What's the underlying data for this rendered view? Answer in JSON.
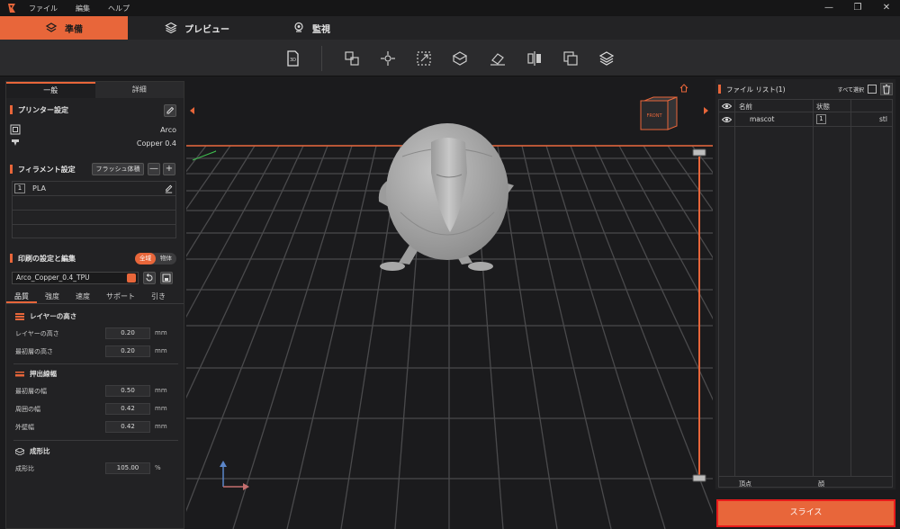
{
  "menu": {
    "items": [
      "ファイル",
      "編集",
      "ヘルプ"
    ]
  },
  "window_controls": {
    "minimize": "—",
    "restore": "❐",
    "close": "✕"
  },
  "mode_tabs": [
    {
      "label": "準備",
      "active": true,
      "icon": "cube-stack-icon"
    },
    {
      "label": "プレビュー",
      "active": false,
      "icon": "layers-icon"
    },
    {
      "label": "監視",
      "active": false,
      "icon": "location-pin-icon"
    }
  ],
  "toolbar": {
    "tools": [
      "import-3d-icon",
      "auto-arrange-icon",
      "move-icon",
      "scale-icon",
      "rotate-icon",
      "lay-flat-icon",
      "mirror-icon",
      "copy-icon",
      "support-icon"
    ]
  },
  "left_panel": {
    "tabs": [
      "一般",
      "詳細"
    ],
    "printer_section": {
      "title": "プリンター設定",
      "printer_name": "Arco",
      "nozzle": "Copper 0.4"
    },
    "filament_section": {
      "title": "フィラメント設定",
      "flush_button": "フラッシュ体積",
      "minus": "—",
      "plus": "+",
      "slots": [
        {
          "num": "1",
          "name": "PLA"
        }
      ]
    },
    "print_section": {
      "title": "印刷の設定と編集",
      "toggle": [
        "全域",
        "物体"
      ],
      "preset": "Arco_Copper_0.4_TPU",
      "sub_tabs": [
        "品質",
        "強度",
        "速度",
        "サポート",
        "引き"
      ],
      "groups": [
        {
          "title": "レイヤーの高さ",
          "params": [
            {
              "label": "レイヤーの高さ",
              "value": "0.20",
              "unit": "mm"
            },
            {
              "label": "最初層の高さ",
              "value": "0.20",
              "unit": "mm"
            }
          ]
        },
        {
          "title": "押出線幅",
          "params": [
            {
              "label": "最初層の幅",
              "value": "0.50",
              "unit": "mm"
            },
            {
              "label": "周囲の幅",
              "value": "0.42",
              "unit": "mm"
            },
            {
              "label": "外壁幅",
              "value": "0.42",
              "unit": "mm"
            }
          ]
        },
        {
          "title": "成形比",
          "params": [
            {
              "label": "成形比",
              "value": "105.00",
              "unit": "%"
            }
          ]
        }
      ]
    }
  },
  "viewport": {
    "cube_label": "FRONT"
  },
  "right_panel": {
    "title": "ファイル リスト(1)",
    "select_all": "すべて選択",
    "columns": {
      "name": "名前",
      "state": "状態"
    },
    "files": [
      {
        "name": "mascot",
        "state": "1",
        "ext": "stl"
      }
    ],
    "footer": {
      "vertices": "頂点",
      "faces": "顔"
    }
  },
  "slice_button": "スライス",
  "colors": {
    "accent": "#e8663a",
    "highlight_border": "#e81b1b",
    "background": "#1b1b1d"
  }
}
